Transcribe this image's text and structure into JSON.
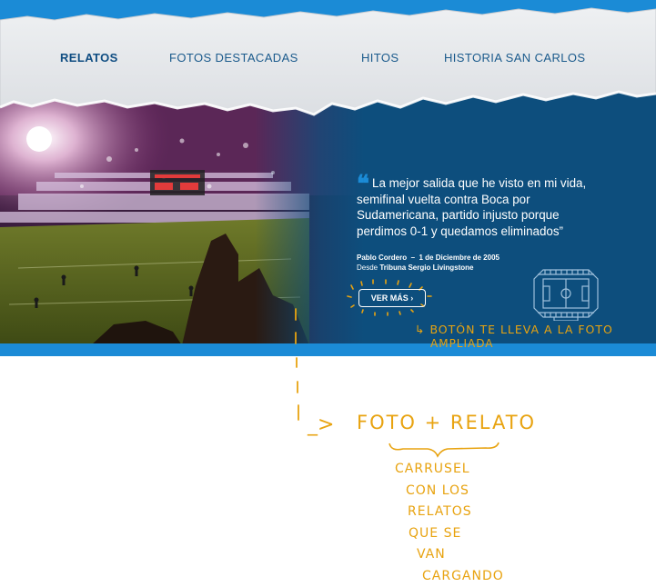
{
  "nav": {
    "items": [
      {
        "label": "RELATOS",
        "active": true
      },
      {
        "label": "FOTOS DESTACADAS",
        "active": false
      },
      {
        "label": "HITOS",
        "active": false
      },
      {
        "label": "HISTORIA SAN CARLOS",
        "active": false
      }
    ]
  },
  "hero": {
    "quote_mark": "❝",
    "quote": "La mejor salida que he visto en mi vida, semifinal vuelta contra Boca por Sudamericana, partido injusto porque perdimos 0-1 y quedamos eliminados”",
    "author": "Pablo Cordero",
    "separator": "–",
    "date": "1 de Diciembre de 2005",
    "location_prefix": "Desde",
    "location": "Tribuna Sergio Livingstone",
    "button_label": "VER MÁS",
    "button_chevron": "›"
  },
  "annotations": {
    "button_note_line1": "↳ BOTÓN TE LLEVA A LA FOTO",
    "button_note_line2": "AMPLIADA",
    "arrow": "_>",
    "foto_relato": "FOTO + RELATO",
    "carrusel_lines": [
      "CARRUSEL",
      "CON LOS",
      "RELATOS",
      "QUE SE",
      "VAN",
      "CARGANDO"
    ]
  },
  "colors": {
    "sky": "#1b8bd6",
    "navy": "#0d4e7d",
    "nav_text": "#1a5a8c",
    "annotation": "#e8a310"
  }
}
